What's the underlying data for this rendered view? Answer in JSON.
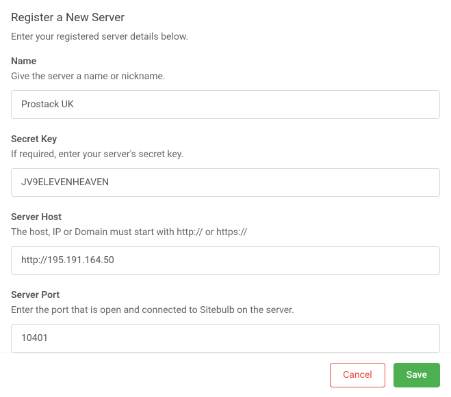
{
  "dialog": {
    "title": "Register a New Server",
    "subtitle": "Enter your registered server details below."
  },
  "fields": {
    "name": {
      "label": "Name",
      "help": "Give the server a name or nickname.",
      "value": "Prostack UK"
    },
    "secret_key": {
      "label": "Secret Key",
      "help": "If required, enter your server's secret key.",
      "value": "JV9ELEVENHEAVEN"
    },
    "server_host": {
      "label": "Server Host",
      "help": "The host, IP or Domain must start with http:// or https://",
      "value": "http://195.191.164.50"
    },
    "server_port": {
      "label": "Server Port",
      "help": "Enter the port that is open and connected to Sitebulb on the server.",
      "value": "10401"
    }
  },
  "buttons": {
    "cancel": "Cancel",
    "save": "Save"
  }
}
